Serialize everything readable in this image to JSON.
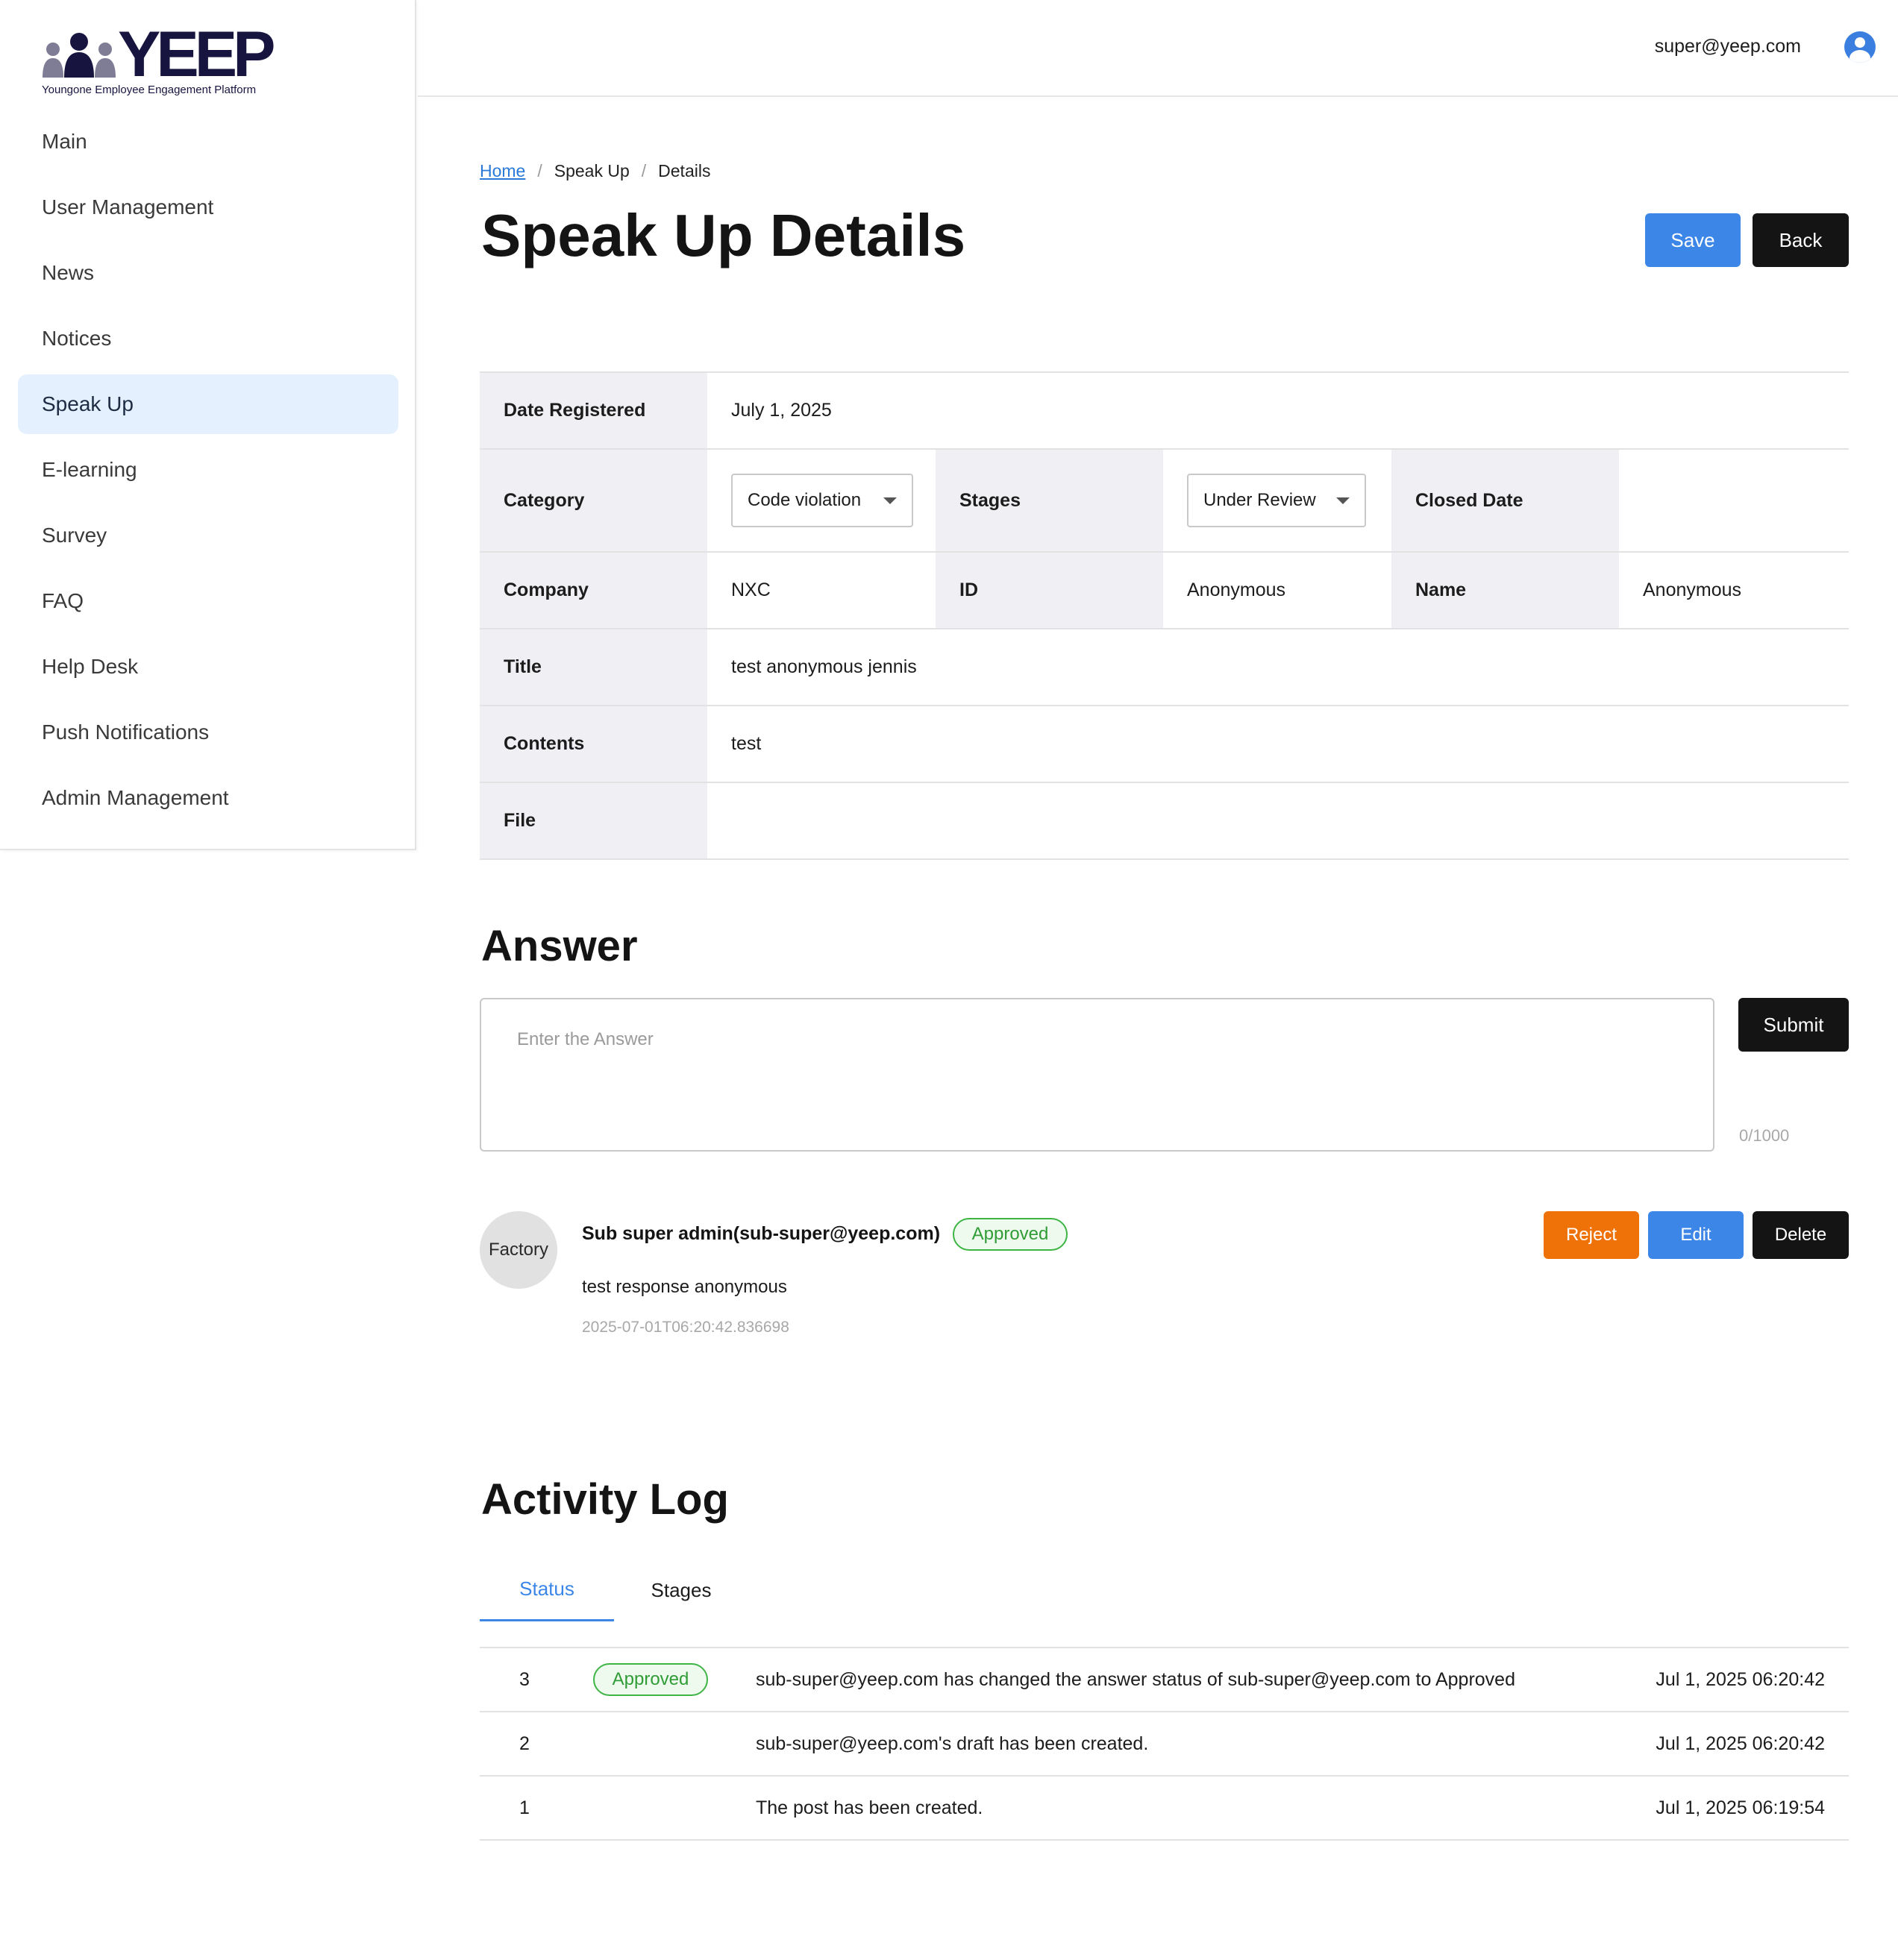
{
  "brand": {
    "name": "YEEP",
    "subtitle": "Youngone Employee Engagement Platform",
    "color": "#17153f"
  },
  "sidebar": {
    "items": [
      {
        "label": "Main"
      },
      {
        "label": "User Management"
      },
      {
        "label": "News"
      },
      {
        "label": "Notices"
      },
      {
        "label": "Speak Up",
        "active": true
      },
      {
        "label": "E-learning"
      },
      {
        "label": "Survey"
      },
      {
        "label": "FAQ"
      },
      {
        "label": "Help Desk"
      },
      {
        "label": "Push Notifications"
      },
      {
        "label": "Admin Management"
      }
    ]
  },
  "header": {
    "user_email": "super@yeep.com",
    "user_icon": "user-circle-icon"
  },
  "breadcrumb": {
    "home": "Home",
    "section": "Speak Up",
    "current": "Details",
    "separator": "/"
  },
  "page": {
    "title": "Speak Up Details",
    "save_label": "Save",
    "back_label": "Back"
  },
  "details": {
    "date_registered_label": "Date Registered",
    "date_registered": "July 1, 2025",
    "category_label": "Category",
    "category_value": "Code violation",
    "stages_label": "Stages",
    "stages_value": "Under Review",
    "closed_date_label": "Closed Date",
    "closed_date": "",
    "company_label": "Company",
    "company": "NXC",
    "id_label": "ID",
    "id": "Anonymous",
    "name_label": "Name",
    "name": "Anonymous",
    "title_label": "Title",
    "title": "test anonymous jennis",
    "contents_label": "Contents",
    "contents": "test",
    "file_label": "File",
    "file": ""
  },
  "answer": {
    "heading": "Answer",
    "placeholder": "Enter the Answer",
    "value": "",
    "submit_label": "Submit",
    "counter": "0/1000"
  },
  "comment": {
    "avatar_text": "Factory",
    "author": "Sub super admin(sub-super@yeep.com)",
    "status": "Approved",
    "text": "test response anonymous",
    "timestamp": "2025-07-01T06:20:42.836698",
    "reject_label": "Reject",
    "edit_label": "Edit",
    "delete_label": "Delete"
  },
  "activity_log": {
    "heading": "Activity Log",
    "tabs": [
      {
        "label": "Status",
        "active": true
      },
      {
        "label": "Stages",
        "active": false
      }
    ],
    "rows": [
      {
        "no": "3",
        "badge": "Approved",
        "message": "sub-super@yeep.com has changed the answer status of sub-super@yeep.com to Approved",
        "date": "Jul 1, 2025 06:20:42"
      },
      {
        "no": "2",
        "badge": "",
        "message": "sub-super@yeep.com's draft has been created.",
        "date": "Jul 1, 2025 06:20:42"
      },
      {
        "no": "1",
        "badge": "",
        "message": "The post has been created.",
        "date": "Jul 1, 2025 06:19:54"
      }
    ]
  },
  "colors": {
    "primary": "#3c86e8",
    "dark": "#141414",
    "reject": "#ef7209",
    "approved": "#3db545",
    "active_nav_bg": "#e4f0fd"
  }
}
